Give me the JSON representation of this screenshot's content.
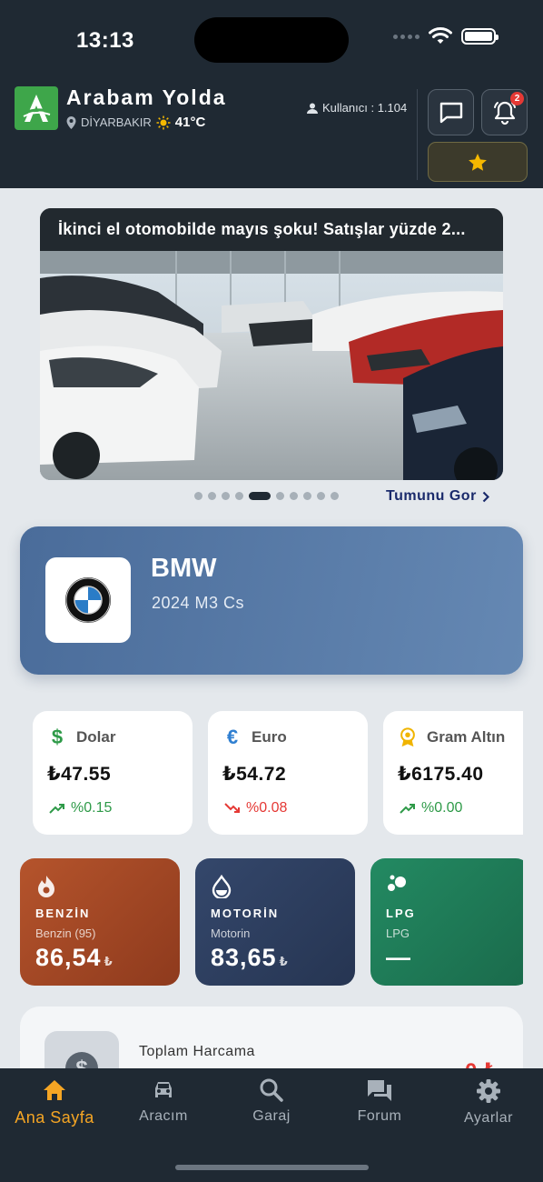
{
  "status_bar": {
    "time": "13:13"
  },
  "header": {
    "app_title": "Arabam Yolda",
    "location": "DİYARBAKIR",
    "temperature": "41°C",
    "users_label": "Kullanıcı : 1.104",
    "notification_count": "2",
    "icons": [
      "location-pin-icon",
      "sun-icon",
      "user-icon",
      "chat-icon",
      "bell-icon",
      "star-icon"
    ]
  },
  "news": {
    "title": "İkinci el otomobilde mayıs şoku! Satışlar yüzde 2...",
    "active_index": 4,
    "count": 10,
    "see_all": "Tumunu Gor"
  },
  "car": {
    "brand": "BMW",
    "model": "2024 M3 Cs"
  },
  "currencies": [
    {
      "name": "Dolar",
      "value": "₺47.55",
      "change": "%0.15",
      "trend": "up",
      "icon": "dollar-icon",
      "color": "#2e9a48"
    },
    {
      "name": "Euro",
      "value": "₺54.72",
      "change": "%0.08",
      "trend": "down",
      "icon": "euro-icon",
      "color": "#2f7fd1"
    },
    {
      "name": "Gram Altın",
      "value": "₺6175.40",
      "change": "%0.00",
      "trend": "up",
      "icon": "gold-medal-icon",
      "color": "#f0b400"
    }
  ],
  "fuel": [
    {
      "label": "BENZİN",
      "sub": "Benzin (95)",
      "price": "86,54",
      "currency": "₺",
      "icon": "flame-icon",
      "color": "#a84a26"
    },
    {
      "label": "MOTORİN",
      "sub": "Motorin",
      "price": "83,65",
      "currency": "₺",
      "icon": "drop-icon",
      "color": "#2d3e5f"
    },
    {
      "label": "LPG",
      "sub": "LPG",
      "price": "—",
      "currency": "",
      "icon": "bubbles-icon",
      "color": "#1f7a58"
    }
  ],
  "spend": {
    "label": "Toplam Harcama",
    "amount": "0 ₺"
  },
  "tabs": [
    {
      "label": "Ana Sayfa",
      "icon": "home-icon",
      "active": true
    },
    {
      "label": "Aracım",
      "icon": "car-icon",
      "active": false
    },
    {
      "label": "Garaj",
      "icon": "search-icon",
      "active": false
    },
    {
      "label": "Forum",
      "icon": "forum-icon",
      "active": false
    },
    {
      "label": "Ayarlar",
      "icon": "gear-icon",
      "active": false
    }
  ],
  "colors": {
    "header_bg": "#1f2933",
    "accent": "#f5a524",
    "up": "#2e9a48",
    "down": "#e53935",
    "link": "#1a2a6b"
  }
}
